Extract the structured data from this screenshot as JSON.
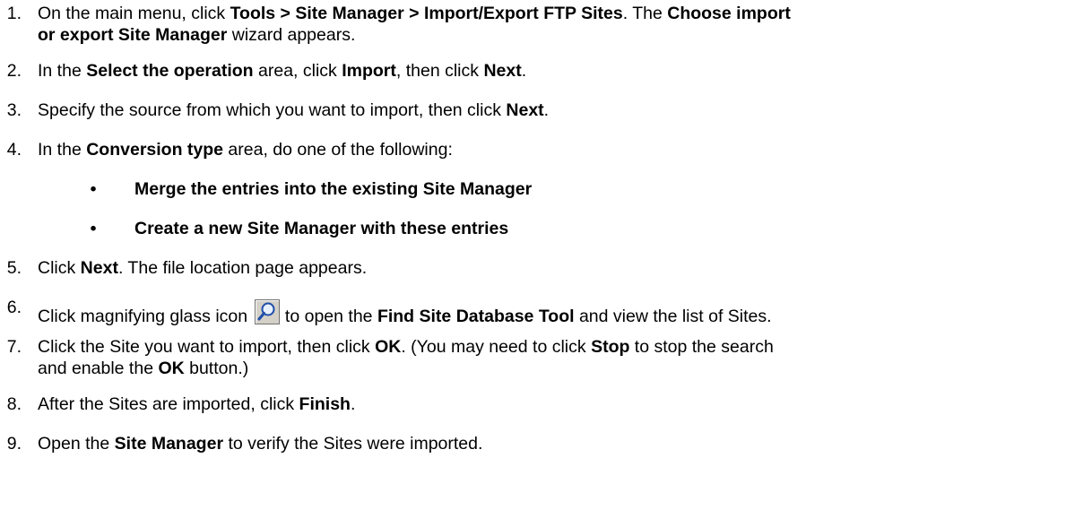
{
  "steps": [
    {
      "num": "1.",
      "line1": {
        "t1": "On the main menu, click ",
        "b1": "Tools > Site Manager > Import/Export FTP Sites",
        "t2": ". The ",
        "b2": "Choose import"
      },
      "line2": {
        "b1": "or export Site Manager",
        "t1": " wizard appears."
      }
    },
    {
      "num": "2.",
      "t1": "In the ",
      "b1": "Select the operation",
      "t2": " area, click ",
      "b2": "Import",
      "t3": ", then click ",
      "b3": "Next",
      "t4": "."
    },
    {
      "num": "3.",
      "t1": "Specify the source from which you want to import, then click ",
      "b1": "Next",
      "t2": "."
    },
    {
      "num": "4.",
      "t1": "In the ",
      "b1": "Conversion type",
      "t2": " area, do one of the following:",
      "bullets": [
        {
          "dot": "•",
          "text": "Merge the entries into the existing Site Manager"
        },
        {
          "dot": "•",
          "text": "Create a new Site Manager with these entries"
        }
      ]
    },
    {
      "num": "5.",
      "t1": "Click ",
      "b1": "Next",
      "t2": ". The file location page appears."
    },
    {
      "num": "6.",
      "t1": "Click magnifying glass icon ",
      "icon": "magnifying-glass-icon",
      "t2": " to open the ",
      "b1": "Find Site Database Tool",
      "t3": " and view the list of Sites."
    },
    {
      "num": "7.",
      "line1": {
        "t1": "Click the Site you want to import, then click ",
        "b1": "OK",
        "t2": ". (You may need to click ",
        "b2": "Stop",
        "t3": " to stop the search"
      },
      "line2": {
        "t1": "and enable the ",
        "b1": "OK",
        "t2": " button.)"
      }
    },
    {
      "num": "8.",
      "t1": "After the Sites are imported, click ",
      "b1": "Finish",
      "t2": "."
    },
    {
      "num": "9.",
      "t1": "Open the ",
      "b1": "Site Manager",
      "t2": " to verify the Sites were imported."
    }
  ],
  "colors": {
    "text": "#000000",
    "icon_bg": "#d4d0c8",
    "icon_glass": "#1f4ea8"
  }
}
